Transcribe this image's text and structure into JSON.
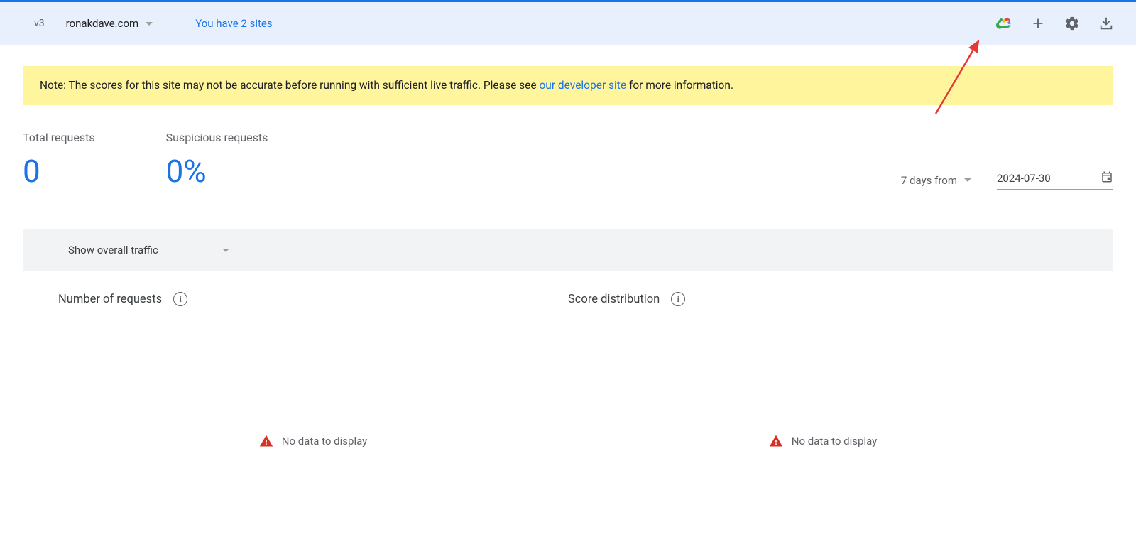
{
  "header": {
    "version": "v3",
    "site_name": "ronakdave.com",
    "sites_link": "You have 2 sites"
  },
  "note": {
    "prefix": "Note:",
    "text_before": " The scores for this site may not be accurate before running with sufficient live traffic. Please see ",
    "link_text": "our developer site",
    "text_after": " for more information."
  },
  "stats": {
    "total_label": "Total requests",
    "total_value": "0",
    "suspicious_label": "Suspicious requests",
    "suspicious_value": "0%"
  },
  "date_controls": {
    "range_label": "7 days from",
    "date_value": "2024-07-30"
  },
  "traffic": {
    "selector_label": "Show overall traffic",
    "chart1_title": "Number of requests",
    "chart2_title": "Score distribution",
    "no_data_text": "No data to display"
  },
  "chart_data": [
    {
      "type": "bar",
      "title": "Number of requests",
      "categories": [],
      "values": [],
      "xlabel": "",
      "ylabel": "",
      "note": "No data to display"
    },
    {
      "type": "bar",
      "title": "Score distribution",
      "categories": [],
      "values": [],
      "xlabel": "",
      "ylabel": "",
      "note": "No data to display"
    }
  ]
}
